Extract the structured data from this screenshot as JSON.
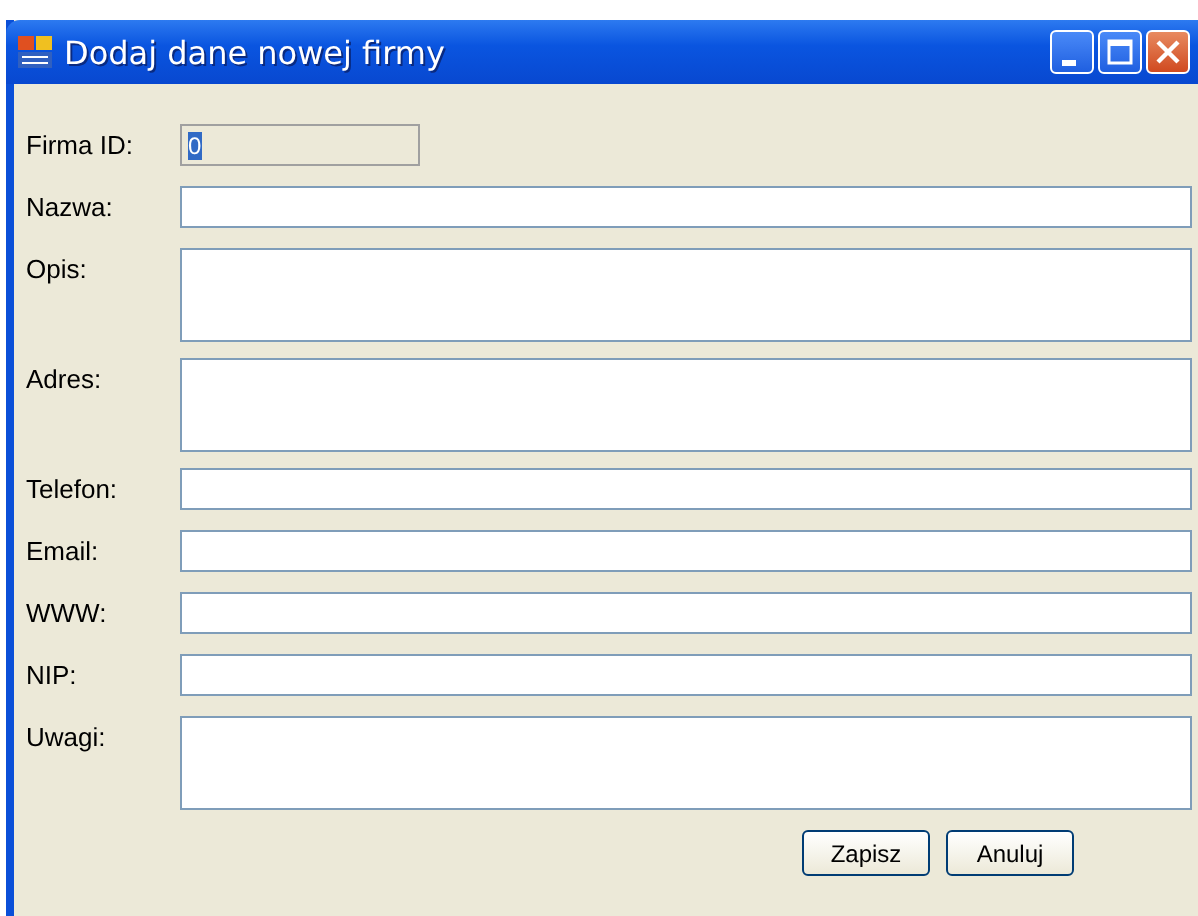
{
  "window": {
    "title": "Dodaj dane nowej firmy"
  },
  "fields": [
    {
      "label": "Firma ID:",
      "kind": "single",
      "value": "0",
      "disabled": true,
      "selected": true
    },
    {
      "label": "Nazwa:",
      "kind": "single",
      "disabled": false
    },
    {
      "label": "Opis:",
      "kind": "multi",
      "disabled": false
    },
    {
      "label": "Adres:",
      "kind": "multi",
      "disabled": false
    },
    {
      "label": "Telefon:",
      "kind": "single",
      "disabled": false
    },
    {
      "label": "Email:",
      "kind": "single",
      "disabled": false
    },
    {
      "label": "WWW:",
      "kind": "single",
      "disabled": false
    },
    {
      "label": "NIP:",
      "kind": "single",
      "disabled": false
    },
    {
      "label": "Uwagi:",
      "kind": "multi",
      "disabled": false
    }
  ],
  "buttons": [
    "Zapisz",
    "Anuluj"
  ]
}
